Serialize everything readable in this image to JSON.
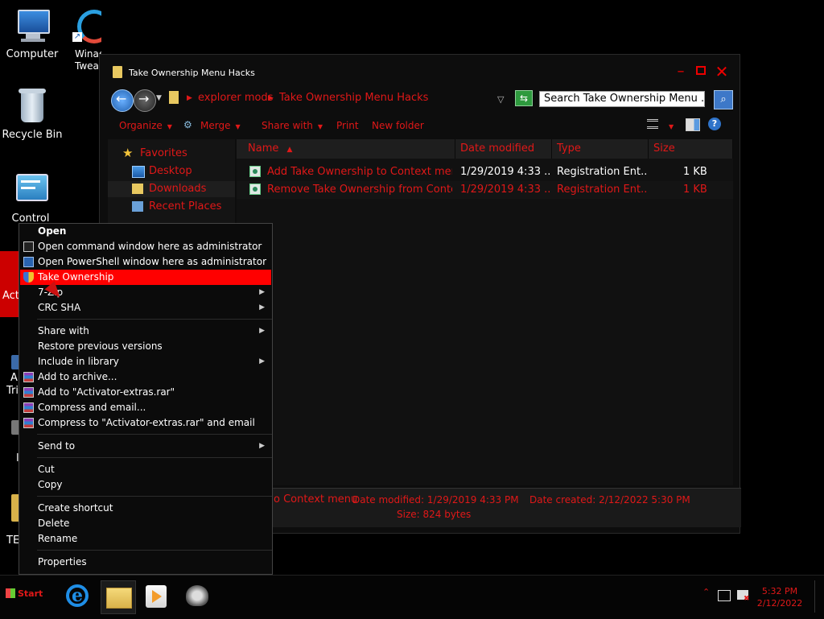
{
  "desktop": {
    "icons": [
      {
        "label": "Computer"
      },
      {
        "label": "Recycle Bin"
      },
      {
        "label": "Control"
      },
      {
        "label": "Winaero\nTwea"
      }
    ],
    "partial_labels": [
      "Act",
      "A",
      "Tri",
      "l",
      "TE"
    ]
  },
  "window": {
    "title": "Take Ownership Menu Hacks",
    "controls": {
      "minimize": "–",
      "close": "✕"
    },
    "address": {
      "crumbs": [
        "explorer mods",
        "Take Ownership Menu Hacks"
      ],
      "search_placeholder": "Search Take Ownership Menu ..."
    },
    "toolbar": {
      "organize": "Organize",
      "merge": "Merge",
      "share_with": "Share with",
      "print": "Print",
      "new_folder": "New folder"
    },
    "nav": {
      "favorites": "Favorites",
      "items": [
        "Desktop",
        "Downloads",
        "Recent Places"
      ]
    },
    "columns": [
      "Name",
      "Date modified",
      "Type",
      "Size"
    ],
    "files": [
      {
        "name": "Add Take Ownership to Context menu",
        "date": "1/29/2019 4:33 ...",
        "type": "Registration Ent...",
        "size": "1 KB"
      },
      {
        "name": "Remove Take Ownership from Conte...",
        "date": "1/29/2019 4:33 ...",
        "type": "Registration Ent...",
        "size": "1 KB"
      }
    ],
    "details": {
      "name_partial": "o Context menu",
      "date_modified": "Date modified: 1/29/2019 4:33 PM",
      "date_created": "Date created: 2/12/2022 5:30 PM",
      "size": "Size: 824 bytes"
    }
  },
  "context_menu": {
    "items": [
      {
        "label": "Open",
        "bold": true
      },
      {
        "label": "Open command window here as administrator",
        "icon": "cmd-icon"
      },
      {
        "label": "Open PowerShell window here as administrator",
        "icon": "powershell-icon"
      },
      {
        "label": "Take Ownership",
        "icon": "shield-icon",
        "highlighted": true
      },
      {
        "label": "7-Zip",
        "submenu": true
      },
      {
        "label": "CRC SHA",
        "submenu": true
      },
      {
        "label": "Share with",
        "submenu": true
      },
      {
        "label": "Restore previous versions"
      },
      {
        "label": "Include in library",
        "submenu": true
      },
      {
        "label": "Add to archive...",
        "icon": "winrar-icon"
      },
      {
        "label": "Add to \"Activator-extras.rar\"",
        "icon": "winrar-icon"
      },
      {
        "label": "Compress and email...",
        "icon": "winrar-icon"
      },
      {
        "label": "Compress to \"Activator-extras.rar\" and email",
        "icon": "winrar-icon"
      },
      {
        "label": "Send to",
        "submenu": true
      },
      {
        "label": "Cut"
      },
      {
        "label": "Copy"
      },
      {
        "label": "Create shortcut"
      },
      {
        "label": "Delete"
      },
      {
        "label": "Rename"
      },
      {
        "label": "Properties"
      }
    ]
  },
  "taskbar": {
    "start_label": "Start",
    "pinned": [
      "internet-explorer-icon",
      "windows-explorer-icon",
      "media-player-icon",
      "raccoon-app-icon"
    ],
    "clock": {
      "time": "5:32 PM",
      "date": "2/12/2022"
    }
  },
  "colors": {
    "accent": "#e01818",
    "highlight": "#ff0000",
    "background": "#000000"
  }
}
